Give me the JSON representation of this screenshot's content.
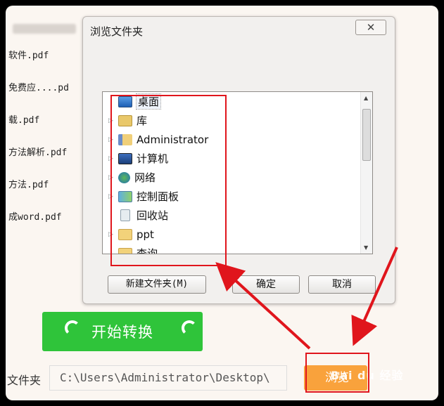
{
  "background": {
    "files": [
      "软件.pdf",
      "免费应....pd",
      "载.pdf",
      "方法解析.pdf",
      "方法.pdf",
      "成word.pdf"
    ],
    "convert_button": "开始转换",
    "output_folder_label": "文件夹",
    "output_path": "C:\\Users\\Administrator\\Desktop\\",
    "browse_button": "浏览",
    "watermark": "Bai du 经验"
  },
  "dialog": {
    "title": "浏览文件夹",
    "close_glyph": "✕",
    "tree": [
      {
        "label": "桌面",
        "icon": "desktop-icon",
        "expandable": false,
        "selected": true
      },
      {
        "label": "库",
        "icon": "library-icon",
        "expandable": true
      },
      {
        "label": "Administrator",
        "icon": "user-folder-icon",
        "expandable": true
      },
      {
        "label": "计算机",
        "icon": "computer-icon",
        "expandable": true
      },
      {
        "label": "网络",
        "icon": "network-icon",
        "expandable": true
      },
      {
        "label": "控制面板",
        "icon": "control-panel-icon",
        "expandable": true
      },
      {
        "label": "回收站",
        "icon": "recycle-bin-icon",
        "expandable": false
      },
      {
        "label": "ppt",
        "icon": "folder-icon",
        "expandable": true
      },
      {
        "label": "查询",
        "icon": "folder-icon",
        "expandable": false
      }
    ],
    "new_folder_button": "新建文件夹(M)",
    "ok_button": "确定",
    "cancel_button": "取消"
  },
  "colors": {
    "highlight_red": "#e0151c",
    "convert_green": "#2fc43a",
    "browse_orange": "#f9a23c"
  }
}
